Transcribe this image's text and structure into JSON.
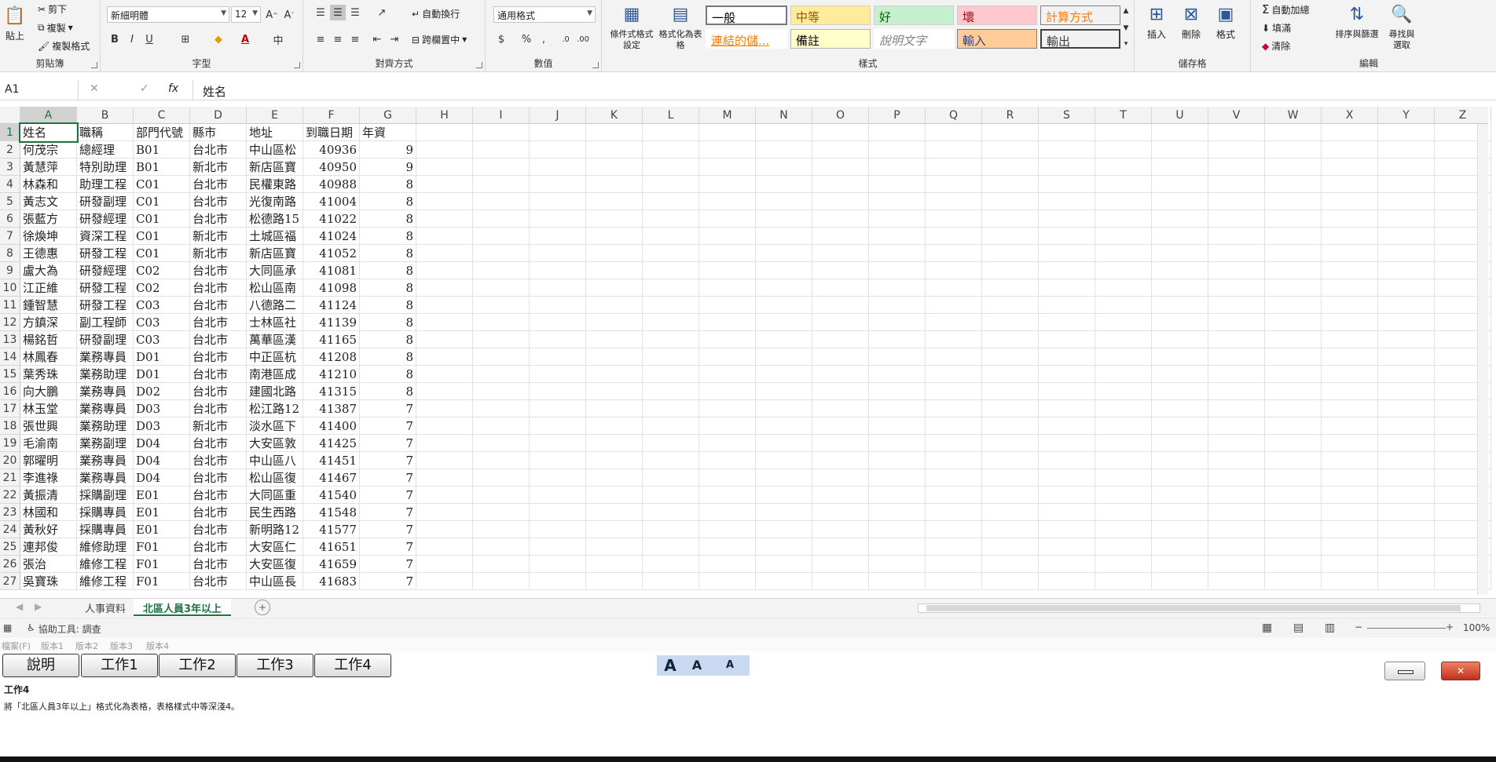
{
  "ribbon": {
    "clipboard": {
      "paste": "貼上",
      "cut": "剪下",
      "copy": "複製",
      "format_painter": "複製格式",
      "label": "剪貼簿"
    },
    "font": {
      "name": "新細明體",
      "size": "12",
      "bold": "B",
      "italic": "I",
      "underline": "U",
      "label": "字型"
    },
    "alignment": {
      "wrap": "自動換行",
      "merge": "跨欄置中",
      "label": "對齊方式"
    },
    "number": {
      "format": "通用格式",
      "currency": "$",
      "percent": "%",
      "comma": ",",
      "label": "數值"
    },
    "styles": {
      "cond_fmt": "條件式格式設定",
      "as_table": "格式化為表格",
      "label": "樣式",
      "cells": [
        "一般",
        "中等",
        "好",
        "壞",
        "計算方式",
        "連結的儲...",
        "備註",
        "說明文字",
        "輸入",
        "輸出"
      ]
    },
    "cells": {
      "insert": "插入",
      "delete": "刪除",
      "format": "格式",
      "label": "儲存格"
    },
    "editing": {
      "autosum": "自動加總",
      "fill": "填滿",
      "clear": "清除",
      "sort": "排序與篩選",
      "find": "尋找與選取",
      "label": "編輯"
    }
  },
  "formula": {
    "name_box": "A1",
    "content": "姓名",
    "fx": "fx"
  },
  "columns": [
    "A",
    "B",
    "C",
    "D",
    "E",
    "F",
    "G",
    "H",
    "I",
    "J",
    "K",
    "L",
    "M",
    "N",
    "O",
    "P",
    "Q",
    "R",
    "S",
    "T",
    "U",
    "V",
    "W",
    "X",
    "Y",
    "Z"
  ],
  "headers": [
    "姓名",
    "職稱",
    "部門代號",
    "縣市",
    "地址",
    "到職日期",
    "年資"
  ],
  "rows": [
    [
      "何茂宗",
      "總經理",
      "B01",
      "台北市",
      "中山區松",
      "40936",
      "9"
    ],
    [
      "黃慧萍",
      "特別助理",
      "B01",
      "新北市",
      "新店區寶",
      "40950",
      "9"
    ],
    [
      "林森和",
      "助理工程",
      "C01",
      "台北市",
      "民權東路",
      "40988",
      "8"
    ],
    [
      "黃志文",
      "研發副理",
      "C01",
      "台北市",
      "光復南路",
      "41004",
      "8"
    ],
    [
      "張藍方",
      "研發經理",
      "C01",
      "台北市",
      "松德路15",
      "41022",
      "8"
    ],
    [
      "徐煥坤",
      "資深工程",
      "C01",
      "新北市",
      "土城區福",
      "41024",
      "8"
    ],
    [
      "王德惠",
      "研發工程",
      "C01",
      "新北市",
      "新店區寶",
      "41052",
      "8"
    ],
    [
      "盧大為",
      "研發經理",
      "C02",
      "台北市",
      "大同區承",
      "41081",
      "8"
    ],
    [
      "江正維",
      "研發工程",
      "C02",
      "台北市",
      "松山區南",
      "41098",
      "8"
    ],
    [
      "鍾智慧",
      "研發工程",
      "C03",
      "台北市",
      "八德路二",
      "41124",
      "8"
    ],
    [
      "方鎮深",
      "副工程師",
      "C03",
      "台北市",
      "士林區社",
      "41139",
      "8"
    ],
    [
      "楊銘哲",
      "研發副理",
      "C03",
      "台北市",
      "萬華區漢",
      "41165",
      "8"
    ],
    [
      "林鳳春",
      "業務專員",
      "D01",
      "台北市",
      "中正區杭",
      "41208",
      "8"
    ],
    [
      "葉秀珠",
      "業務助理",
      "D01",
      "台北市",
      "南港區成",
      "41210",
      "8"
    ],
    [
      "向大鵬",
      "業務專員",
      "D02",
      "台北市",
      "建國北路",
      "41315",
      "8"
    ],
    [
      "林玉堂",
      "業務專員",
      "D03",
      "台北市",
      "松江路12",
      "41387",
      "7"
    ],
    [
      "張世興",
      "業務助理",
      "D03",
      "新北市",
      "淡水區下",
      "41400",
      "7"
    ],
    [
      "毛渝南",
      "業務副理",
      "D04",
      "台北市",
      "大安區敦",
      "41425",
      "7"
    ],
    [
      "郭曜明",
      "業務專員",
      "D04",
      "台北市",
      "中山區八",
      "41451",
      "7"
    ],
    [
      "李進祿",
      "業務專員",
      "D04",
      "台北市",
      "松山區復",
      "41467",
      "7"
    ],
    [
      "黃振清",
      "採購副理",
      "E01",
      "台北市",
      "大同區重",
      "41540",
      "7"
    ],
    [
      "林國和",
      "採購專員",
      "E01",
      "台北市",
      "民生西路",
      "41548",
      "7"
    ],
    [
      "黃秋好",
      "採購專員",
      "E01",
      "台北市",
      "新明路12",
      "41577",
      "7"
    ],
    [
      "連邦俊",
      "維修助理",
      "F01",
      "台北市",
      "大安區仁",
      "41651",
      "7"
    ],
    [
      "張治",
      "維修工程",
      "F01",
      "台北市",
      "大安區復",
      "41659",
      "7"
    ],
    [
      "吳寶珠",
      "維修工程",
      "F01",
      "台北市",
      "中山區長",
      "41683",
      "7"
    ]
  ],
  "sheets": {
    "tab1": "人事資料",
    "tab2": "北區人員3年以上",
    "add": "+"
  },
  "status": {
    "accessibility": "協助工具: 調查",
    "zoom": "100%"
  },
  "versions": [
    "檔案(F)",
    "版本1",
    "版本2",
    "版本3",
    "版本4"
  ],
  "panel": {
    "buttons": [
      "說明",
      "工作1",
      "工作2",
      "工作3",
      "工作4"
    ],
    "font_sizes": [
      "A",
      "A",
      "A"
    ],
    "task_title": "工作4",
    "task_text": "將「北區人員3年以上」格式化為表格，表格樣式中等深淺4。"
  }
}
